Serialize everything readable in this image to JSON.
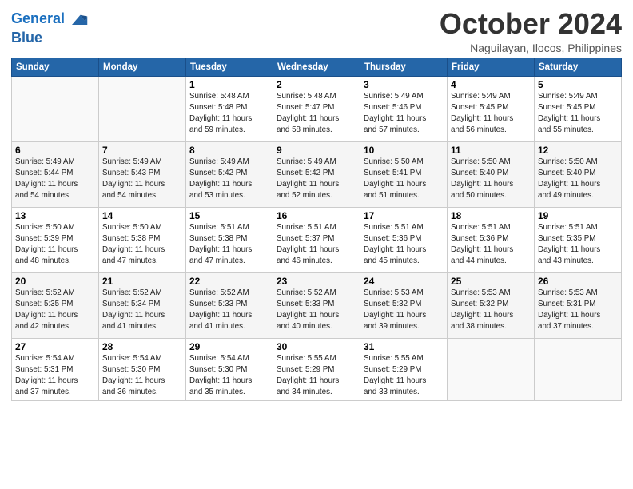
{
  "logo": {
    "line1": "General",
    "line2": "Blue"
  },
  "title": "October 2024",
  "subtitle": "Naguilayan, Ilocos, Philippines",
  "weekdays": [
    "Sunday",
    "Monday",
    "Tuesday",
    "Wednesday",
    "Thursday",
    "Friday",
    "Saturday"
  ],
  "weeks": [
    [
      {
        "day": "",
        "detail": ""
      },
      {
        "day": "",
        "detail": ""
      },
      {
        "day": "1",
        "detail": "Sunrise: 5:48 AM\nSunset: 5:48 PM\nDaylight: 11 hours\nand 59 minutes."
      },
      {
        "day": "2",
        "detail": "Sunrise: 5:48 AM\nSunset: 5:47 PM\nDaylight: 11 hours\nand 58 minutes."
      },
      {
        "day": "3",
        "detail": "Sunrise: 5:49 AM\nSunset: 5:46 PM\nDaylight: 11 hours\nand 57 minutes."
      },
      {
        "day": "4",
        "detail": "Sunrise: 5:49 AM\nSunset: 5:45 PM\nDaylight: 11 hours\nand 56 minutes."
      },
      {
        "day": "5",
        "detail": "Sunrise: 5:49 AM\nSunset: 5:45 PM\nDaylight: 11 hours\nand 55 minutes."
      }
    ],
    [
      {
        "day": "6",
        "detail": "Sunrise: 5:49 AM\nSunset: 5:44 PM\nDaylight: 11 hours\nand 54 minutes."
      },
      {
        "day": "7",
        "detail": "Sunrise: 5:49 AM\nSunset: 5:43 PM\nDaylight: 11 hours\nand 54 minutes."
      },
      {
        "day": "8",
        "detail": "Sunrise: 5:49 AM\nSunset: 5:42 PM\nDaylight: 11 hours\nand 53 minutes."
      },
      {
        "day": "9",
        "detail": "Sunrise: 5:49 AM\nSunset: 5:42 PM\nDaylight: 11 hours\nand 52 minutes."
      },
      {
        "day": "10",
        "detail": "Sunrise: 5:50 AM\nSunset: 5:41 PM\nDaylight: 11 hours\nand 51 minutes."
      },
      {
        "day": "11",
        "detail": "Sunrise: 5:50 AM\nSunset: 5:40 PM\nDaylight: 11 hours\nand 50 minutes."
      },
      {
        "day": "12",
        "detail": "Sunrise: 5:50 AM\nSunset: 5:40 PM\nDaylight: 11 hours\nand 49 minutes."
      }
    ],
    [
      {
        "day": "13",
        "detail": "Sunrise: 5:50 AM\nSunset: 5:39 PM\nDaylight: 11 hours\nand 48 minutes."
      },
      {
        "day": "14",
        "detail": "Sunrise: 5:50 AM\nSunset: 5:38 PM\nDaylight: 11 hours\nand 47 minutes."
      },
      {
        "day": "15",
        "detail": "Sunrise: 5:51 AM\nSunset: 5:38 PM\nDaylight: 11 hours\nand 47 minutes."
      },
      {
        "day": "16",
        "detail": "Sunrise: 5:51 AM\nSunset: 5:37 PM\nDaylight: 11 hours\nand 46 minutes."
      },
      {
        "day": "17",
        "detail": "Sunrise: 5:51 AM\nSunset: 5:36 PM\nDaylight: 11 hours\nand 45 minutes."
      },
      {
        "day": "18",
        "detail": "Sunrise: 5:51 AM\nSunset: 5:36 PM\nDaylight: 11 hours\nand 44 minutes."
      },
      {
        "day": "19",
        "detail": "Sunrise: 5:51 AM\nSunset: 5:35 PM\nDaylight: 11 hours\nand 43 minutes."
      }
    ],
    [
      {
        "day": "20",
        "detail": "Sunrise: 5:52 AM\nSunset: 5:35 PM\nDaylight: 11 hours\nand 42 minutes."
      },
      {
        "day": "21",
        "detail": "Sunrise: 5:52 AM\nSunset: 5:34 PM\nDaylight: 11 hours\nand 41 minutes."
      },
      {
        "day": "22",
        "detail": "Sunrise: 5:52 AM\nSunset: 5:33 PM\nDaylight: 11 hours\nand 41 minutes."
      },
      {
        "day": "23",
        "detail": "Sunrise: 5:52 AM\nSunset: 5:33 PM\nDaylight: 11 hours\nand 40 minutes."
      },
      {
        "day": "24",
        "detail": "Sunrise: 5:53 AM\nSunset: 5:32 PM\nDaylight: 11 hours\nand 39 minutes."
      },
      {
        "day": "25",
        "detail": "Sunrise: 5:53 AM\nSunset: 5:32 PM\nDaylight: 11 hours\nand 38 minutes."
      },
      {
        "day": "26",
        "detail": "Sunrise: 5:53 AM\nSunset: 5:31 PM\nDaylight: 11 hours\nand 37 minutes."
      }
    ],
    [
      {
        "day": "27",
        "detail": "Sunrise: 5:54 AM\nSunset: 5:31 PM\nDaylight: 11 hours\nand 37 minutes."
      },
      {
        "day": "28",
        "detail": "Sunrise: 5:54 AM\nSunset: 5:30 PM\nDaylight: 11 hours\nand 36 minutes."
      },
      {
        "day": "29",
        "detail": "Sunrise: 5:54 AM\nSunset: 5:30 PM\nDaylight: 11 hours\nand 35 minutes."
      },
      {
        "day": "30",
        "detail": "Sunrise: 5:55 AM\nSunset: 5:29 PM\nDaylight: 11 hours\nand 34 minutes."
      },
      {
        "day": "31",
        "detail": "Sunrise: 5:55 AM\nSunset: 5:29 PM\nDaylight: 11 hours\nand 33 minutes."
      },
      {
        "day": "",
        "detail": ""
      },
      {
        "day": "",
        "detail": ""
      }
    ]
  ]
}
